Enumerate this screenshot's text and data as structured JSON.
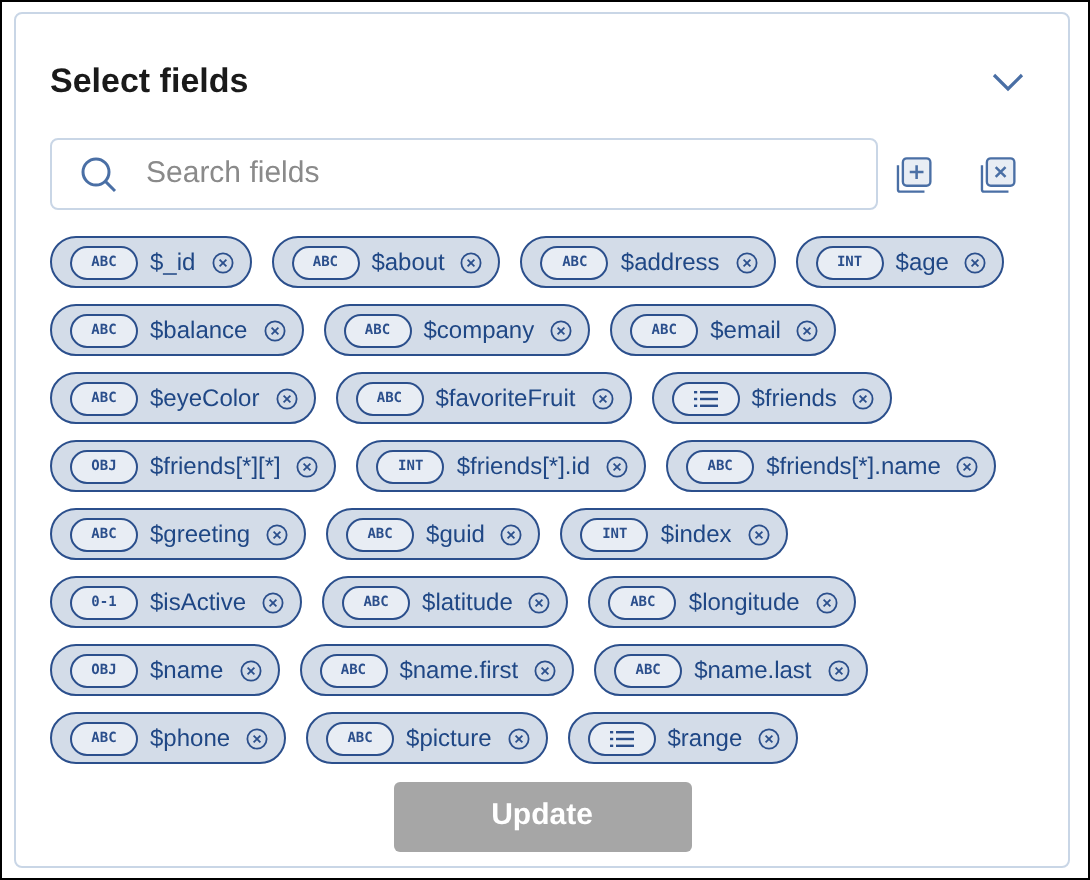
{
  "title": "Select fields",
  "expanded": true,
  "search": {
    "placeholder": "Search fields"
  },
  "fields": [
    {
      "name": "$_id",
      "kind": "scalar",
      "badge": "ABC"
    },
    {
      "name": "$about",
      "kind": "scalar",
      "badge": "ABC"
    },
    {
      "name": "$address",
      "kind": "scalar",
      "badge": "ABC"
    },
    {
      "name": "$age",
      "kind": "scalar",
      "badge": "INT"
    },
    {
      "name": "$balance",
      "kind": "scalar",
      "badge": "ABC"
    },
    {
      "name": "$company",
      "kind": "scalar",
      "badge": "ABC"
    },
    {
      "name": "$email",
      "kind": "scalar",
      "badge": "ABC"
    },
    {
      "name": "$eyeColor",
      "kind": "scalar",
      "badge": "ABC"
    },
    {
      "name": "$favoriteFruit",
      "kind": "scalar",
      "badge": "ABC"
    },
    {
      "name": "$friends",
      "kind": "array"
    },
    {
      "name": "$friends[*][*]",
      "kind": "scalar",
      "badge": "OBJ"
    },
    {
      "name": "$friends[*].id",
      "kind": "scalar",
      "badge": "INT"
    },
    {
      "name": "$friends[*].name",
      "kind": "scalar",
      "badge": "ABC"
    },
    {
      "name": "$greeting",
      "kind": "scalar",
      "badge": "ABC"
    },
    {
      "name": "$guid",
      "kind": "scalar",
      "badge": "ABC"
    },
    {
      "name": "$index",
      "kind": "scalar",
      "badge": "INT"
    },
    {
      "name": "$isActive",
      "kind": "scalar",
      "badge": "0-1"
    },
    {
      "name": "$latitude",
      "kind": "scalar",
      "badge": "ABC"
    },
    {
      "name": "$longitude",
      "kind": "scalar",
      "badge": "ABC"
    },
    {
      "name": "$name",
      "kind": "scalar",
      "badge": "OBJ"
    },
    {
      "name": "$name.first",
      "kind": "scalar",
      "badge": "ABC"
    },
    {
      "name": "$name.last",
      "kind": "scalar",
      "badge": "ABC"
    },
    {
      "name": "$phone",
      "kind": "scalar",
      "badge": "ABC"
    },
    {
      "name": "$picture",
      "kind": "scalar",
      "badge": "ABC"
    },
    {
      "name": "$range",
      "kind": "array"
    }
  ],
  "update_button": {
    "label": "Update",
    "disabled": true
  }
}
